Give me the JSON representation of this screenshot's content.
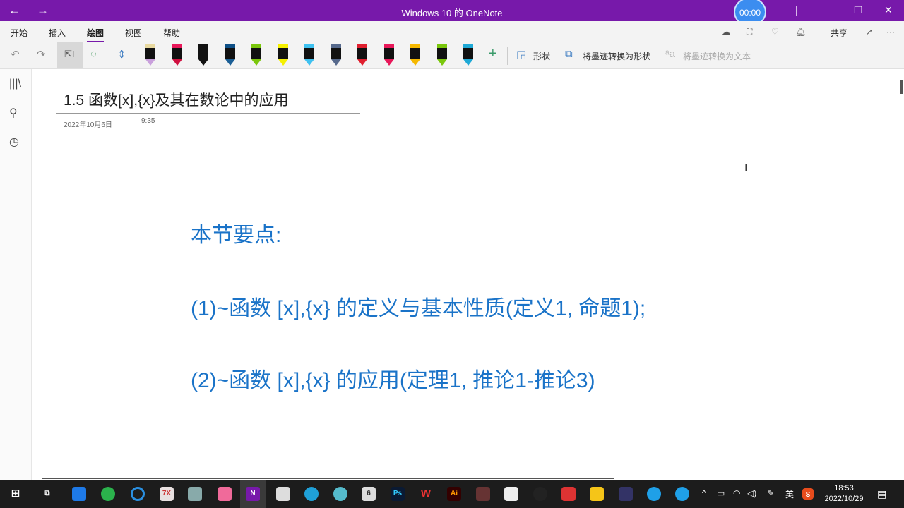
{
  "window": {
    "title": "Windows 10 的 OneNote",
    "timer": "00:00",
    "back": "←",
    "forward": "→",
    "minimize": "—",
    "restore": "❐",
    "close": "✕"
  },
  "menu": {
    "tabs": [
      "开始",
      "插入",
      "绘图",
      "视图",
      "帮助"
    ],
    "active": 2,
    "share": "共享"
  },
  "toolbar": {
    "shapes": "形状",
    "ink_to_shape": "将墨迹转换为形状",
    "ink_to_text": "将墨迹转换为文本",
    "pens": [
      {
        "cap": "#e8d9a0",
        "body": "#111",
        "tip": "#c9a0dc"
      },
      {
        "cap": "#e8185a",
        "body": "#111",
        "tip": "#d01040"
      },
      {
        "cap": "#111",
        "body": "#111",
        "tip": "#111"
      },
      {
        "cap": "#0e4f86",
        "body": "#111",
        "tip": "#1b5f96"
      },
      {
        "cap": "#7ac70c",
        "body": "#111",
        "tip": "#7ac70c"
      },
      {
        "cap": "#f5f000",
        "body": "#111",
        "tip": "#f5f000"
      },
      {
        "cap": "#3fc1f0",
        "body": "#111",
        "tip": "#3fc1f0"
      },
      {
        "cap": "#56698c",
        "body": "#111",
        "tip": "#56698c"
      },
      {
        "cap": "#e01f2f",
        "body": "#111",
        "tip": "#e01f2f"
      },
      {
        "cap": "#e8185a",
        "body": "#111",
        "tip": "#e8185a"
      },
      {
        "cap": "#f5b800",
        "body": "#111",
        "tip": "#f5b800"
      },
      {
        "cap": "#7ac70c",
        "body": "#111",
        "tip": "#7ac70c"
      },
      {
        "cap": "#1fa9d6",
        "body": "#111",
        "tip": "#1fa9d6"
      }
    ]
  },
  "page": {
    "title": "1.5 函数[x],{x}及其在数论中的应用",
    "date": "2022年10月6日",
    "time": "9:35",
    "lines": [
      "本节要点:",
      "(1)~函数 [x],{x} 的定义与基本性质(定义1, 命题1);",
      "(2)~函数 [x],{x} 的应用(定理1, 推论1-推论3)"
    ]
  },
  "taskbar": {
    "time": "18:53",
    "date": "2022/10/29",
    "ime": "英"
  },
  "colors": {
    "accent": "#7719aa",
    "note_text": "#1a73c8"
  }
}
